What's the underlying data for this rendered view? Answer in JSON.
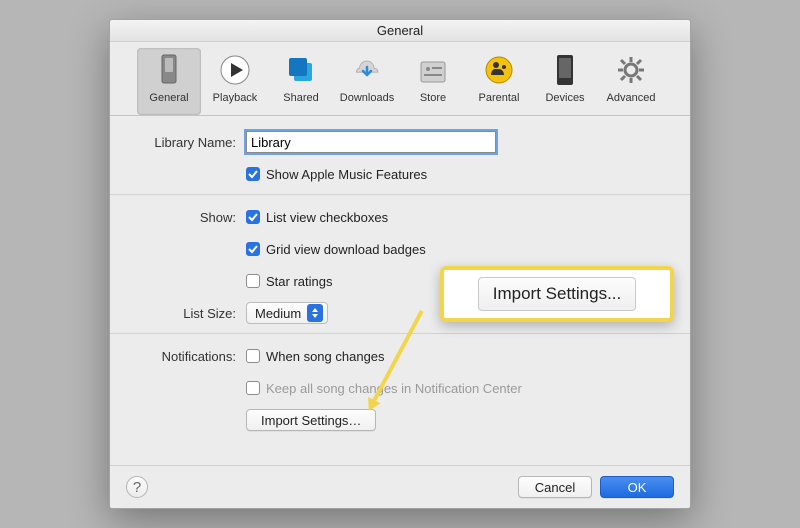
{
  "title": "General",
  "toolbar": [
    {
      "id": "general",
      "label": "General"
    },
    {
      "id": "playback",
      "label": "Playback"
    },
    {
      "id": "shared",
      "label": "Shared"
    },
    {
      "id": "downloads",
      "label": "Downloads"
    },
    {
      "id": "store",
      "label": "Store"
    },
    {
      "id": "parental",
      "label": "Parental"
    },
    {
      "id": "devices",
      "label": "Devices"
    },
    {
      "id": "advanced",
      "label": "Advanced"
    }
  ],
  "selected_tab": "general",
  "labels": {
    "library_name": "Library Name:",
    "show": "Show:",
    "list_size": "List Size:",
    "notifications": "Notifications:"
  },
  "fields": {
    "library_name_value": "Library",
    "show_apple_music": {
      "checked": true,
      "label": "Show Apple Music Features"
    },
    "list_view_checkboxes": {
      "checked": true,
      "label": "List view checkboxes"
    },
    "grid_view_badges": {
      "checked": true,
      "label": "Grid view download badges"
    },
    "star_ratings": {
      "checked": false,
      "label": "Star ratings"
    },
    "list_size_value": "Medium",
    "when_song_changes": {
      "checked": false,
      "label": "When song changes"
    },
    "keep_in_nc": {
      "checked": false,
      "label": "Keep all song changes in Notification Center",
      "disabled": true
    },
    "import_settings_button": "Import Settings…"
  },
  "footer": {
    "cancel": "Cancel",
    "ok": "OK",
    "help": "?"
  },
  "callout_text": "Import Settings..."
}
